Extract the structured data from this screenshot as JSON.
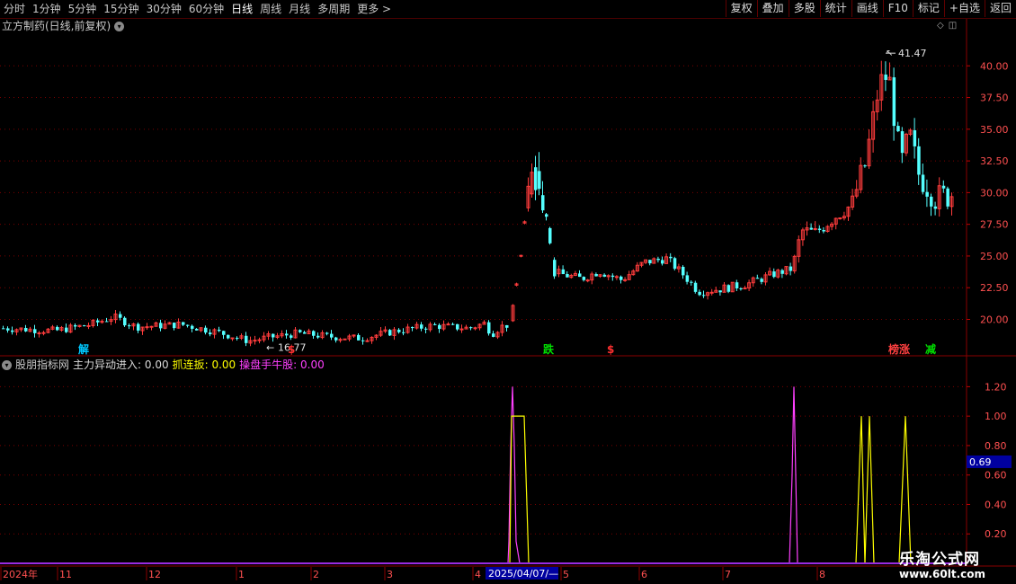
{
  "toolbar": {
    "periods": [
      "分时",
      "1分钟",
      "5分钟",
      "15分钟",
      "30分钟",
      "60分钟",
      "日线",
      "周线",
      "月线",
      "多周期",
      "更多 >"
    ],
    "active_period": "日线",
    "right_buttons": [
      "复权",
      "叠加",
      "多股",
      "统计",
      "画线",
      "F10",
      "标记",
      "+自选",
      "返回"
    ]
  },
  "main_chart": {
    "title": "立方制药(日线,前复权)",
    "price_ticks": [
      "40.00",
      "37.50",
      "35.00",
      "32.50",
      "30.00",
      "27.50",
      "25.00",
      "22.50",
      "20.00"
    ],
    "high_label": "41.47",
    "low_label": "16.77",
    "signals": [
      {
        "text": "解",
        "color": "#00c8ff"
      },
      {
        "text": "$",
        "color": "#ff3030"
      },
      {
        "text": "跌",
        "color": "#00e000"
      },
      {
        "text": "$",
        "color": "#ff3030"
      },
      {
        "text": "榜",
        "color": "#ff4040"
      },
      {
        "text": "涨",
        "color": "#ff4040"
      },
      {
        "text": "减",
        "color": "#00e000"
      }
    ]
  },
  "indicator": {
    "name": "股朋指标网",
    "lines": [
      {
        "label": "主力异动进入: 0.00",
        "color": "#d8d8d8"
      },
      {
        "label": "抓连扳: 0.00",
        "color": "#ffff00"
      },
      {
        "label": "操盘手牛股: 0.00",
        "color": "#ff40ff"
      }
    ],
    "ticks": [
      "1.20",
      "1.00",
      "0.80",
      "0.60",
      "0.40",
      "0.20"
    ],
    "current_value": "0.69"
  },
  "time_axis": {
    "labels": [
      "2024年",
      "11",
      "12",
      "1",
      "2",
      "3",
      "4",
      "5",
      "6",
      "7",
      "8"
    ],
    "cursor_date": "2025/04/07/—"
  },
  "watermark": {
    "title": "乐淘公式网",
    "url": "www.60lt.com"
  },
  "colors": {
    "up": "#ff3c3c",
    "down": "#54ffff",
    "grid": "#7a0000",
    "axis": "#8a0000"
  },
  "chart_data": {
    "type": "candlestick",
    "ylim": [
      17.2,
      42.5
    ],
    "indicator_ylim": [
      0,
      1.3
    ]
  }
}
